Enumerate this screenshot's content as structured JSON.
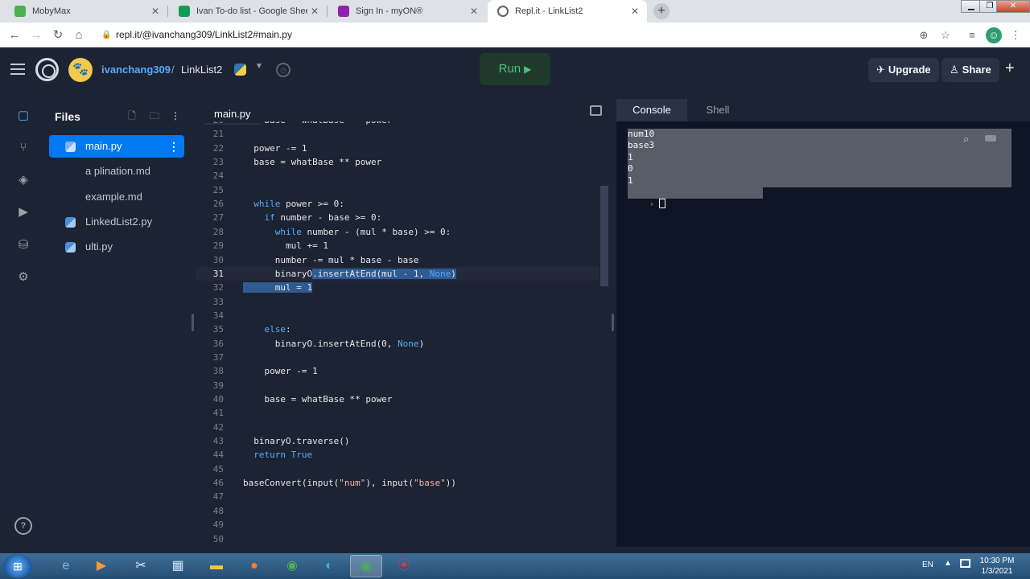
{
  "browser": {
    "tabs": [
      {
        "title": "MobyMax",
        "favicon_color": "#4caf50"
      },
      {
        "title": "Ivan To-do list - Google Sheets",
        "favicon_color": "#0f9d58"
      },
      {
        "title": "Sign In - myON®",
        "favicon_color": "#8e24aa"
      },
      {
        "title": "Repl.it - LinkList2",
        "favicon_color": "#5f6368"
      }
    ],
    "url": "repl.it/@ivanchang309/LinkList2#main.py"
  },
  "header": {
    "username": "ivanchang309",
    "separator": "/",
    "repl_name": "LinkList2",
    "run_label": "Run",
    "upgrade_label": "Upgrade",
    "share_label": "Share"
  },
  "rail": {
    "help_label": "?"
  },
  "files": {
    "title": "Files",
    "items": [
      {
        "name": "main.py",
        "type": "python",
        "selected": true
      },
      {
        "name": "a plination.md",
        "type": "markdown",
        "selected": false
      },
      {
        "name": "example.md",
        "type": "markdown",
        "selected": false
      },
      {
        "name": "LinkedList2.py",
        "type": "python",
        "selected": false
      },
      {
        "name": "ulti.py",
        "type": "python",
        "selected": false
      }
    ]
  },
  "editor": {
    "tab_label": "main.py",
    "current_line": 31,
    "lines": [
      {
        "n": "20",
        "code": "    base = whatBase ** power"
      },
      {
        "n": "21",
        "code": ""
      },
      {
        "n": "22",
        "code": "  power -= 1"
      },
      {
        "n": "23",
        "code": "  base = whatBase ** power"
      },
      {
        "n": "24",
        "code": ""
      },
      {
        "n": "25",
        "code": ""
      },
      {
        "n": "26",
        "code": "  while power >= 0:"
      },
      {
        "n": "27",
        "code": "    if number - base >= 0:"
      },
      {
        "n": "28",
        "code": "      while number - (mul * base) >= 0:"
      },
      {
        "n": "29",
        "code": "        mul += 1"
      },
      {
        "n": "30",
        "code": "      number -= mul * base - base"
      },
      {
        "n": "31",
        "code": "      binaryO.insertAtEnd(mul - 1, None)"
      },
      {
        "n": "32",
        "code": "      mul = 1"
      },
      {
        "n": "33",
        "code": ""
      },
      {
        "n": "34",
        "code": ""
      },
      {
        "n": "35",
        "code": "    else:"
      },
      {
        "n": "36",
        "code": "      binaryO.insertAtEnd(0, None)"
      },
      {
        "n": "37",
        "code": ""
      },
      {
        "n": "38",
        "code": "    power -= 1"
      },
      {
        "n": "39",
        "code": ""
      },
      {
        "n": "40",
        "code": "    base = whatBase ** power"
      },
      {
        "n": "41",
        "code": ""
      },
      {
        "n": "42",
        "code": ""
      },
      {
        "n": "43",
        "code": "  binaryO.traverse()"
      },
      {
        "n": "44",
        "code": "  return True"
      },
      {
        "n": "45",
        "code": ""
      },
      {
        "n": "46",
        "code": "baseConvert(input(\"num\"), input(\"base\"))"
      },
      {
        "n": "47",
        "code": ""
      },
      {
        "n": "48",
        "code": ""
      },
      {
        "n": "49",
        "code": ""
      },
      {
        "n": "50",
        "code": ""
      }
    ]
  },
  "console": {
    "tab_console": "Console",
    "tab_shell": "Shell",
    "output_lines": [
      "num10",
      "base3",
      "1",
      "0",
      "1"
    ],
    "prompt": "›"
  },
  "taskbar": {
    "language": "EN",
    "time": "10:30 PM",
    "date": "1/3/2021"
  }
}
